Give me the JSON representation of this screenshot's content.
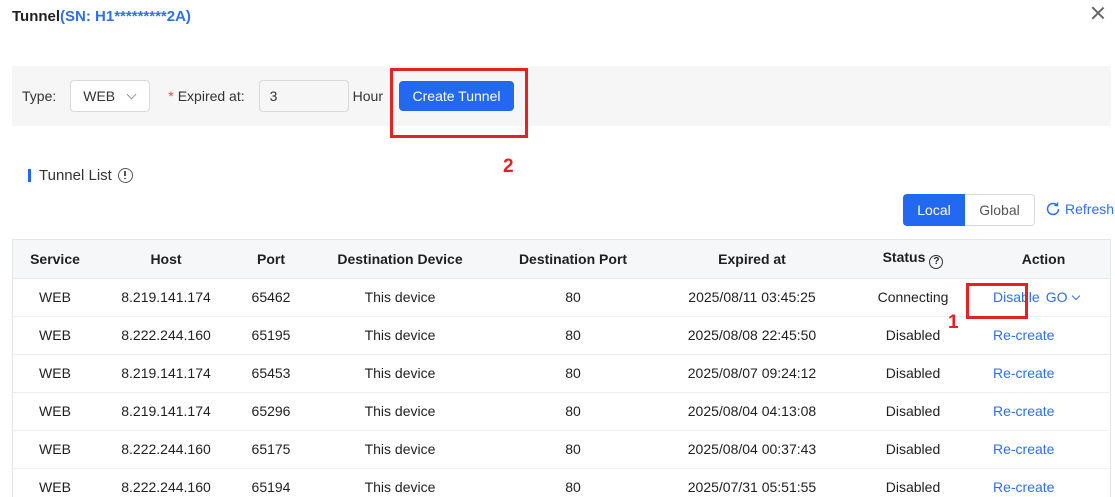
{
  "dialog": {
    "title": "Tunnel",
    "sn_text": "(SN: H1*********2A)"
  },
  "form": {
    "type_label": "Type:",
    "type_value": "WEB",
    "required_mark": "*",
    "expired_label": "Expired at:",
    "expired_value": "3",
    "hour_label": "Hour",
    "create_button": "Create Tunnel"
  },
  "annotations": {
    "one": "1",
    "two": "2"
  },
  "section": {
    "title": "Tunnel List"
  },
  "toggle": {
    "local": "Local",
    "global": "Global"
  },
  "refresh_label": "Refresh",
  "table": {
    "headers": [
      "Service",
      "Host",
      "Port",
      "Destination Device",
      "Destination Port",
      "Expired at",
      "Status",
      "Action"
    ],
    "help_glyph": "?",
    "rows": [
      {
        "service": "WEB",
        "host": "8.219.141.174",
        "port": "65462",
        "device": "This device",
        "dport": "80",
        "expired": "2025/08/11 03:45:25",
        "status": "Connecting",
        "action": "Disable",
        "action2": "GO"
      },
      {
        "service": "WEB",
        "host": "8.222.244.160",
        "port": "65195",
        "device": "This device",
        "dport": "80",
        "expired": "2025/08/08 22:45:50",
        "status": "Disabled",
        "action": "Re-create"
      },
      {
        "service": "WEB",
        "host": "8.219.141.174",
        "port": "65453",
        "device": "This device",
        "dport": "80",
        "expired": "2025/08/07 09:24:12",
        "status": "Disabled",
        "action": "Re-create"
      },
      {
        "service": "WEB",
        "host": "8.219.141.174",
        "port": "65296",
        "device": "This device",
        "dport": "80",
        "expired": "2025/08/04 04:13:08",
        "status": "Disabled",
        "action": "Re-create"
      },
      {
        "service": "WEB",
        "host": "8.222.244.160",
        "port": "65175",
        "device": "This device",
        "dport": "80",
        "expired": "2025/08/04 00:37:43",
        "status": "Disabled",
        "action": "Re-create"
      },
      {
        "service": "WEB",
        "host": "8.222.244.160",
        "port": "65194",
        "device": "This device",
        "dport": "80",
        "expired": "2025/07/31 05:51:55",
        "status": "Disabled",
        "action": "Re-create"
      }
    ]
  },
  "colors": {
    "primary": "#2368f0",
    "link": "#2f6fea",
    "annotation": "#e32222"
  }
}
